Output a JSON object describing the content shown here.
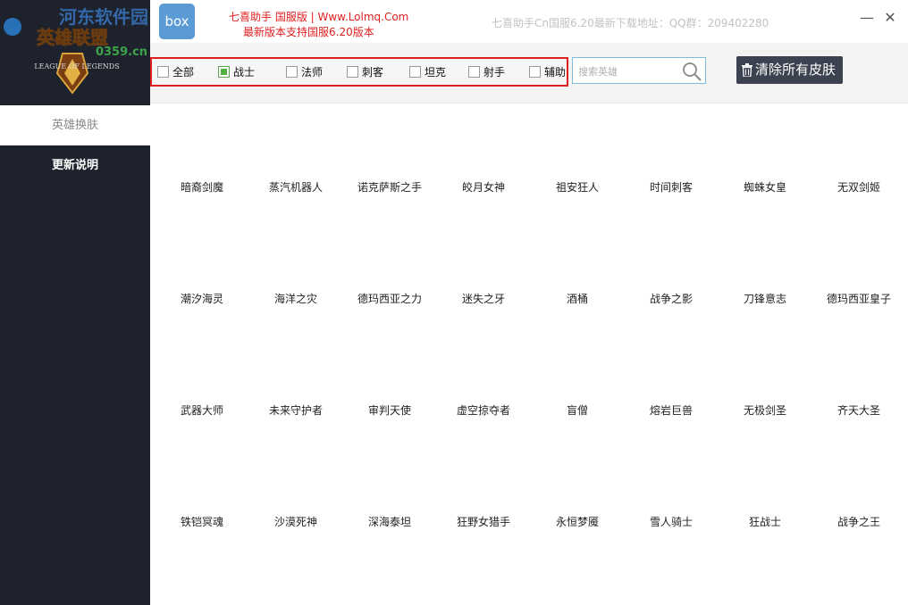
{
  "header": {
    "box_label": "box",
    "line1": "七喜助手 国服版 | Www.Lolmq.Com",
    "line2": "最新版本支持国服6.20版本",
    "right_info": "七喜助手Cn国服6.20最新下载地址：QQ群：209402280",
    "minimize": "—",
    "close": "✕"
  },
  "logo": {
    "watermark": "河东软件园",
    "site": "0359.cn",
    "game_name_cn": "英雄联盟",
    "game_name_en": "LEAGUE OF LEGENDS"
  },
  "sidebar": {
    "items": [
      {
        "label": "英雄换肤",
        "active": true
      },
      {
        "label": "更新说明",
        "active": false
      }
    ]
  },
  "filters": [
    {
      "label": "全部",
      "checked": false
    },
    {
      "label": "战士",
      "checked": true
    },
    {
      "label": "法师",
      "checked": false
    },
    {
      "label": "刺客",
      "checked": false
    },
    {
      "label": "坦克",
      "checked": false
    },
    {
      "label": "射手",
      "checked": false
    },
    {
      "label": "辅助",
      "checked": false
    }
  ],
  "search": {
    "placeholder": "搜索英雄",
    "value": ""
  },
  "clear_button": {
    "label": "清除所有皮肤"
  },
  "colors": {
    "sidebar": "#1e222c",
    "accent_red": "#e02020",
    "check_green": "#52b043",
    "button_dark": "#3c4250"
  },
  "heroes": [
    [
      "暗裔剑魔",
      "蒸汽机器人",
      "诺克萨斯之手",
      "皎月女神",
      "祖安狂人",
      "时间刺客",
      "蜘蛛女皇",
      "无双剑姬"
    ],
    [
      "潮汐海灵",
      "海洋之灾",
      "德玛西亚之力",
      "迷失之牙",
      "酒桶",
      "战争之影",
      "刀锋意志",
      "德玛西亚皇子"
    ],
    [
      "武器大师",
      "未来守护者",
      "审判天使",
      "虚空掠夺者",
      "盲僧",
      "熔岩巨兽",
      "无极剑圣",
      "齐天大圣"
    ],
    [
      "铁铠冥魂",
      "沙漠死神",
      "深海泰坦",
      "狂野女猎手",
      "永恒梦魇",
      "雪人骑士",
      "狂战士",
      "战争之王"
    ]
  ]
}
